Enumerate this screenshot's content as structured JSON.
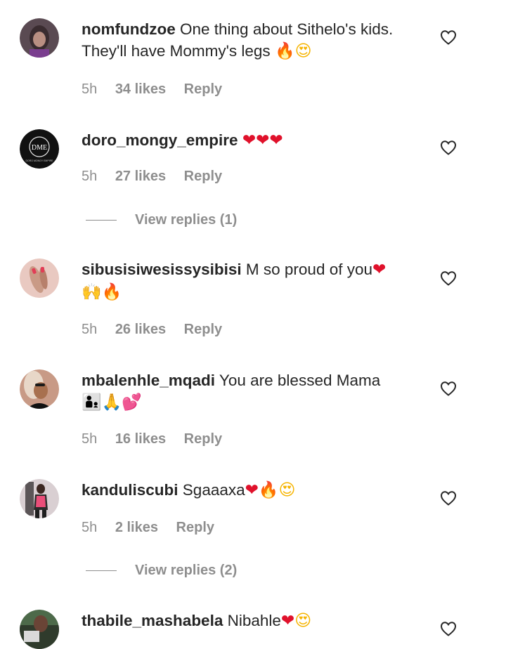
{
  "comments": [
    {
      "username": "nomfundzoe",
      "text": "One thing about Sithelo's kids. They'll have Mommy's legs",
      "emoji": [
        {
          "char": "🔥",
          "color": "orange"
        },
        {
          "char": "😍",
          "color": "yellow"
        }
      ],
      "time": "5h",
      "likes": "34 likes",
      "reply": "Reply"
    },
    {
      "username": "doro_mongy_empire",
      "text": "",
      "emoji": [
        {
          "char": "❤",
          "color": "red"
        },
        {
          "char": "❤",
          "color": "red"
        },
        {
          "char": "❤",
          "color": "red"
        }
      ],
      "time": "5h",
      "likes": "27 likes",
      "reply": "Reply",
      "view_replies": "View replies (1)"
    },
    {
      "username": "sibusisiwesissysibisi",
      "text": "M so proud of you",
      "emoji": [
        {
          "char": "❤",
          "color": "red"
        },
        {
          "char": "🙌",
          "color": "yellow"
        },
        {
          "char": "🔥",
          "color": "orange"
        }
      ],
      "time": "5h",
      "likes": "26 likes",
      "reply": "Reply"
    },
    {
      "username": "mbalenhle_mqadi",
      "text": "You are blessed Mama",
      "emoji": [
        {
          "char": "👨‍👦",
          "color": "yellow"
        },
        {
          "char": "🙏",
          "color": "yellow"
        },
        {
          "char": "💕",
          "color": "red"
        }
      ],
      "time": "5h",
      "likes": "16 likes",
      "reply": "Reply"
    },
    {
      "username": "kanduliscubi",
      "text": "Sgaaaxa",
      "emoji": [
        {
          "char": "❤",
          "color": "red"
        },
        {
          "char": "🔥",
          "color": "orange"
        },
        {
          "char": "😍",
          "color": "yellow"
        }
      ],
      "time": "5h",
      "likes": "2 likes",
      "reply": "Reply",
      "view_replies": "View replies (2)"
    },
    {
      "username": "thabile_mashabela",
      "text": "Nibahle",
      "emoji": [
        {
          "char": "❤",
          "color": "red"
        },
        {
          "char": "😍",
          "color": "yellow"
        }
      ]
    }
  ],
  "avatars": [
    {
      "name": "nomfundzoe-avatar",
      "bg": "#5a4a52"
    },
    {
      "name": "doro-mongy-empire-avatar",
      "bg": "#111111",
      "logo_text": "DME",
      "logo_subtext": "DORO MONGY EMPIRE"
    },
    {
      "name": "sibusisiwesissysibisi-avatar",
      "bg": "#e9c9c1"
    },
    {
      "name": "mbalenhle-mqadi-avatar",
      "bg": "#c89a86"
    },
    {
      "name": "kanduliscubi-avatar",
      "bg": "#d9cfd2"
    },
    {
      "name": "thabile-mashabela-avatar",
      "bg": "#4d6a4a"
    }
  ]
}
